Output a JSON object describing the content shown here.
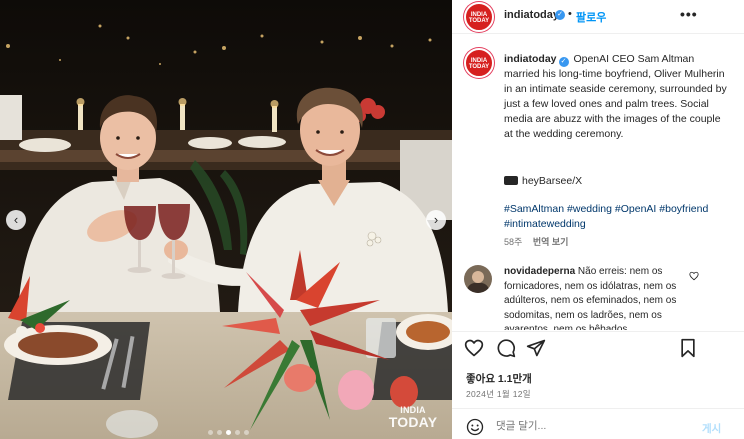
{
  "post": {
    "username": "indiatoday",
    "follow_label": "팔로우",
    "separator": "•",
    "more_label": "•••",
    "verified_glyph": "✓",
    "avatar_line1": "INDIA",
    "avatar_line2": "TODAY",
    "caption": "OpenAI CEO Sam Altman married his long-time boyfriend, Oliver Mulherin in an intimate seaside ceremony, surrounded by just a few loved ones and palm trees. Social media are abuzz with the images of the couple at the wedding ceremony.",
    "credit": "heyBarsee/X",
    "hashtags": "#SamAltman #wedding #OpenAI #boyfriend #intimatewedding",
    "caption_age": "58주",
    "translate_label": "번역 보기",
    "likes": "좋아요 1.1만개",
    "date": "2024년 1월 12일",
    "comment_placeholder": "댓글 달기...",
    "post_label": "게시"
  },
  "comment": {
    "username": "novidadeperna",
    "text": "Não erreis: nem os fornicadores, nem os idólatras, nem os adúlteros, nem os efeminados, nem os sodomitas, nem os ladrões, nem os avarentos, nem os bêbados"
  },
  "photo": {
    "watermark_line1": "INDIA",
    "watermark_line2": "TODAY",
    "prev_glyph": "‹",
    "next_glyph": "›",
    "carousel_count": 5,
    "carousel_active": 3
  },
  "icons": {
    "like": "heart-icon",
    "comment": "comment-icon",
    "share": "paper-plane-icon",
    "save": "bookmark-icon",
    "emoji": "smiley-icon",
    "credit": "camera-icon",
    "comment_like": "heart-icon"
  },
  "colors": {
    "link_blue": "#0095f6",
    "hashtag": "#00376b",
    "secondary_text": "#737373",
    "post_disabled": "#b2dffc",
    "verified": "#3897f0",
    "brand_red": "#d6201f"
  }
}
